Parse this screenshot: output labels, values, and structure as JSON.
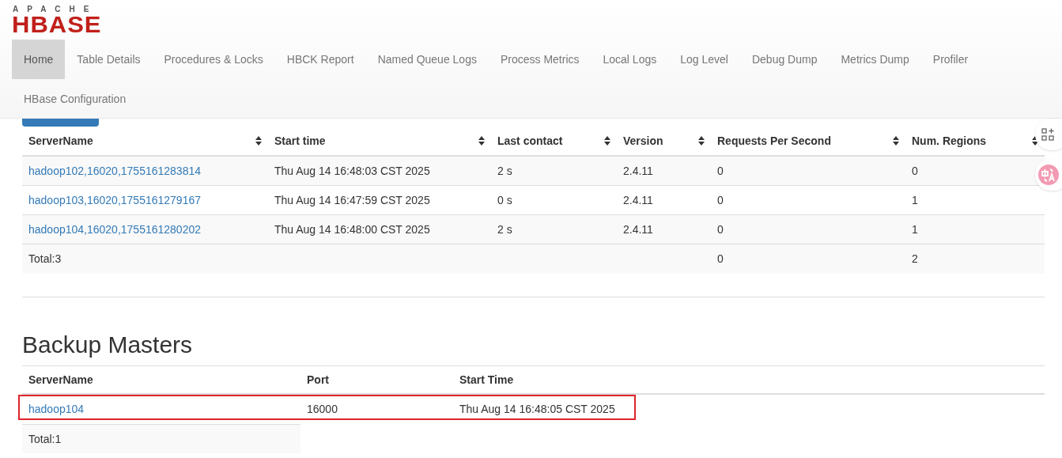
{
  "logo": {
    "top": "APACHE",
    "main": "HBASE"
  },
  "nav": [
    {
      "label": "Home",
      "selected": true
    },
    {
      "label": "Table Details",
      "selected": false
    },
    {
      "label": "Procedures & Locks",
      "selected": false
    },
    {
      "label": "HBCK Report",
      "selected": false
    },
    {
      "label": "Named Queue Logs",
      "selected": false
    },
    {
      "label": "Process Metrics",
      "selected": false
    },
    {
      "label": "Local Logs",
      "selected": false
    },
    {
      "label": "Log Level",
      "selected": false
    },
    {
      "label": "Debug Dump",
      "selected": false
    },
    {
      "label": "Metrics Dump",
      "selected": false
    },
    {
      "label": "Profiler",
      "selected": false
    },
    {
      "label": "HBase Configuration",
      "selected": false
    }
  ],
  "region_servers": {
    "columns": [
      "ServerName",
      "Start time",
      "Last contact",
      "Version",
      "Requests Per Second",
      "Num. Regions"
    ],
    "rows": [
      [
        "hadoop102,16020,1755161283814",
        "Thu Aug 14 16:48:03 CST 2025",
        "2 s",
        "2.4.11",
        "0",
        "0"
      ],
      [
        "hadoop103,16020,1755161279167",
        "Thu Aug 14 16:47:59 CST 2025",
        "0 s",
        "2.4.11",
        "0",
        "1"
      ],
      [
        "hadoop104,16020,1755161280202",
        "Thu Aug 14 16:48:00 CST 2025",
        "2 s",
        "2.4.11",
        "0",
        "1"
      ]
    ],
    "total": {
      "label": "Total:3",
      "requests": "0",
      "regions": "2"
    }
  },
  "backup_masters": {
    "title": "Backup Masters",
    "columns": [
      "ServerName",
      "Port",
      "Start Time"
    ],
    "rows": [
      {
        "cells": [
          "hadoop104",
          "16000",
          "Thu Aug 14 16:48:05 CST 2025"
        ],
        "highlighted": true
      }
    ],
    "total": "Total:1"
  }
}
